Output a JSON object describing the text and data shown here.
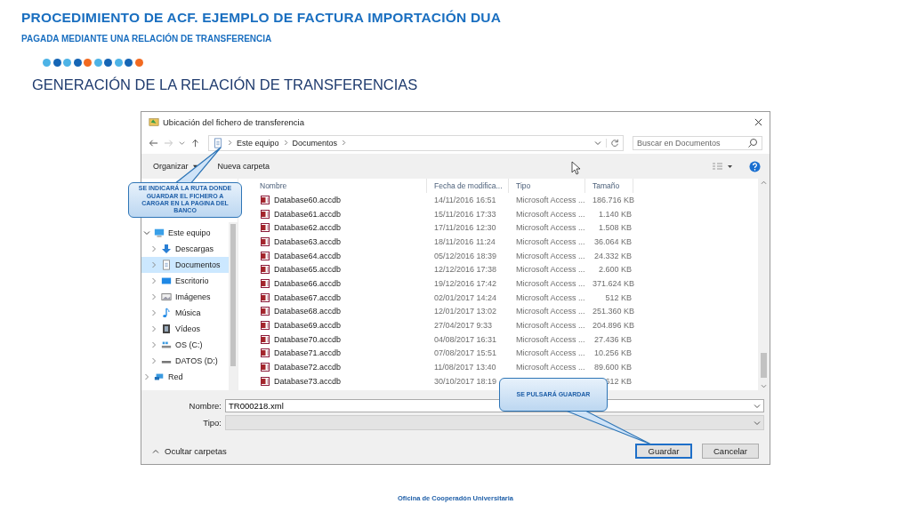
{
  "slide": {
    "title": "PROCEDIMIENTO DE ACF. EJEMPLO DE FACTURA IMPORTACIÓN DUA",
    "subtitle": "PAGADA MEDIANTE UNA RELACIÓN DE TRANSFERENCIA",
    "dots": [
      {
        "color": "#4db3e6"
      },
      {
        "color": "#1565b5"
      },
      {
        "color": "#4db3e6"
      },
      {
        "color": "#1565b5"
      },
      {
        "color": "#f26a21"
      },
      {
        "color": "#4db3e6"
      },
      {
        "color": "#1565b5"
      },
      {
        "color": "#4db3e6"
      },
      {
        "color": "#1565b5"
      },
      {
        "color": "#f26a21"
      }
    ],
    "section_title": "GENERACIÓN DE LA RELACIÓN DE TRANSFERENCIAS"
  },
  "dialog": {
    "title": "Ubicación del fichero de transferencia",
    "breadcrumb": [
      "Este equipo",
      "Documentos"
    ],
    "search": {
      "placeholder": "Buscar en Documentos"
    },
    "toolbar": {
      "organize": "Organizar",
      "new_folder": "Nueva carpeta"
    },
    "nav_tree": [
      {
        "label": "Este equipo",
        "kind": "computer",
        "expanded": true,
        "selected": false,
        "children": [
          {
            "label": "Descargas",
            "kind": "downloads",
            "expanded": false,
            "selected": false
          },
          {
            "label": "Documentos",
            "kind": "documents",
            "expanded": false,
            "selected": true
          },
          {
            "label": "Escritorio",
            "kind": "desktop",
            "expanded": false,
            "selected": false
          },
          {
            "label": "Imágenes",
            "kind": "pictures",
            "expanded": false,
            "selected": false
          },
          {
            "label": "Música",
            "kind": "music",
            "expanded": false,
            "selected": false
          },
          {
            "label": "Vídeos",
            "kind": "videos",
            "expanded": false,
            "selected": false
          },
          {
            "label": "OS (C:)",
            "kind": "system-drive",
            "expanded": false,
            "selected": false
          },
          {
            "label": "DATOS (D:)",
            "kind": "drive",
            "expanded": false,
            "selected": false
          }
        ]
      },
      {
        "label": "Red",
        "kind": "network",
        "expanded": false,
        "selected": false
      }
    ],
    "columns": [
      "Nombre",
      "Fecha de modifica...",
      "Tipo",
      "Tamaño"
    ],
    "rows": [
      {
        "name": "Database60.accdb",
        "date": "14/11/2016 16:51",
        "type": "Microsoft Access ...",
        "size": "186.716 KB"
      },
      {
        "name": "Database61.accdb",
        "date": "15/11/2016 17:33",
        "type": "Microsoft Access ...",
        "size": "1.140 KB"
      },
      {
        "name": "Database62.accdb",
        "date": "17/11/2016 12:30",
        "type": "Microsoft Access ...",
        "size": "1.508 KB"
      },
      {
        "name": "Database63.accdb",
        "date": "18/11/2016 11:24",
        "type": "Microsoft Access ...",
        "size": "36.064 KB"
      },
      {
        "name": "Database64.accdb",
        "date": "05/12/2016 18:39",
        "type": "Microsoft Access ...",
        "size": "24.332 KB"
      },
      {
        "name": "Database65.accdb",
        "date": "12/12/2016 17:38",
        "type": "Microsoft Access ...",
        "size": "2.600 KB"
      },
      {
        "name": "Database66.accdb",
        "date": "19/12/2016 17:42",
        "type": "Microsoft Access ...",
        "size": "371.624 KB"
      },
      {
        "name": "Database67.accdb",
        "date": "02/01/2017 14:24",
        "type": "Microsoft Access ...",
        "size": "512 KB"
      },
      {
        "name": "Database68.accdb",
        "date": "12/01/2017 13:02",
        "type": "Microsoft Access ...",
        "size": "251.360 KB"
      },
      {
        "name": "Database69.accdb",
        "date": "27/04/2017 9:33",
        "type": "Microsoft Access ...",
        "size": "204.896 KB"
      },
      {
        "name": "Database70.accdb",
        "date": "04/08/2017 16:31",
        "type": "Microsoft Access ...",
        "size": "27.436 KB"
      },
      {
        "name": "Database71.accdb",
        "date": "07/08/2017 15:51",
        "type": "Microsoft Access ...",
        "size": "10.256 KB"
      },
      {
        "name": "Database72.accdb",
        "date": "11/08/2017 13:40",
        "type": "Microsoft Access ...",
        "size": "89.600 KB"
      },
      {
        "name": "Database73.accdb",
        "date": "30/10/2017 18:19",
        "size": "612 KB"
      }
    ],
    "filename": {
      "label": "Nombre:",
      "value": "TR000218.xml"
    },
    "file_type": {
      "label": "Tipo:"
    },
    "hide_folders": "Ocultar carpetas",
    "buttons": [
      {
        "label": "Guardar",
        "default": true
      },
      {
        "label": "Cancelar",
        "default": false
      }
    ]
  },
  "callouts": [
    {
      "text": "SE INDICARÁ LA RUTA DONDE GUARDAR EL FICHERO A CARGAR EN LA PAGINA DEL BANCO"
    },
    {
      "text": "SE PULSARÁ GUARDAR"
    }
  ],
  "footer": "Oficina de Cooperadón Universitaria"
}
